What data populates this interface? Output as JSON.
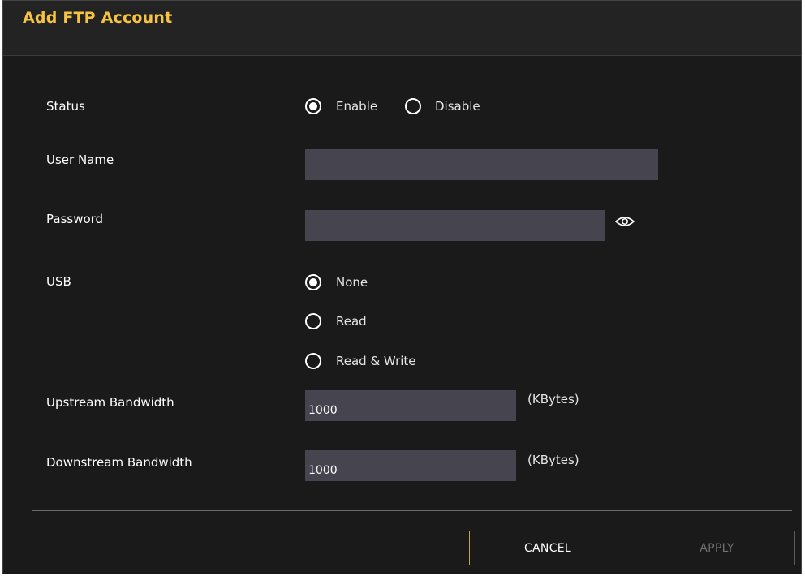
{
  "dialog": {
    "title": "Add FTP Account"
  },
  "form": {
    "status": {
      "label": "Status",
      "options": [
        "Enable",
        "Disable"
      ],
      "selected": "Enable"
    },
    "user_name": {
      "label": "User Name",
      "value": ""
    },
    "password": {
      "label": "Password",
      "value": "",
      "toggle_icon": "eye-icon"
    },
    "usb": {
      "label": "USB",
      "options": [
        "None",
        "Read",
        "Read & Write"
      ],
      "selected": "None"
    },
    "upstream": {
      "label": "Upstream Bandwidth",
      "value": "1000",
      "unit": "(KBytes)"
    },
    "downstream": {
      "label": "Downstream Bandwidth",
      "value": "1000",
      "unit": "(KBytes)"
    }
  },
  "buttons": {
    "cancel": "CANCEL",
    "apply": "APPLY"
  },
  "colors": {
    "title": "#f5c242",
    "background": "#1a1a1a",
    "field": "#46444f",
    "cancel_border": "#c9a13e"
  }
}
